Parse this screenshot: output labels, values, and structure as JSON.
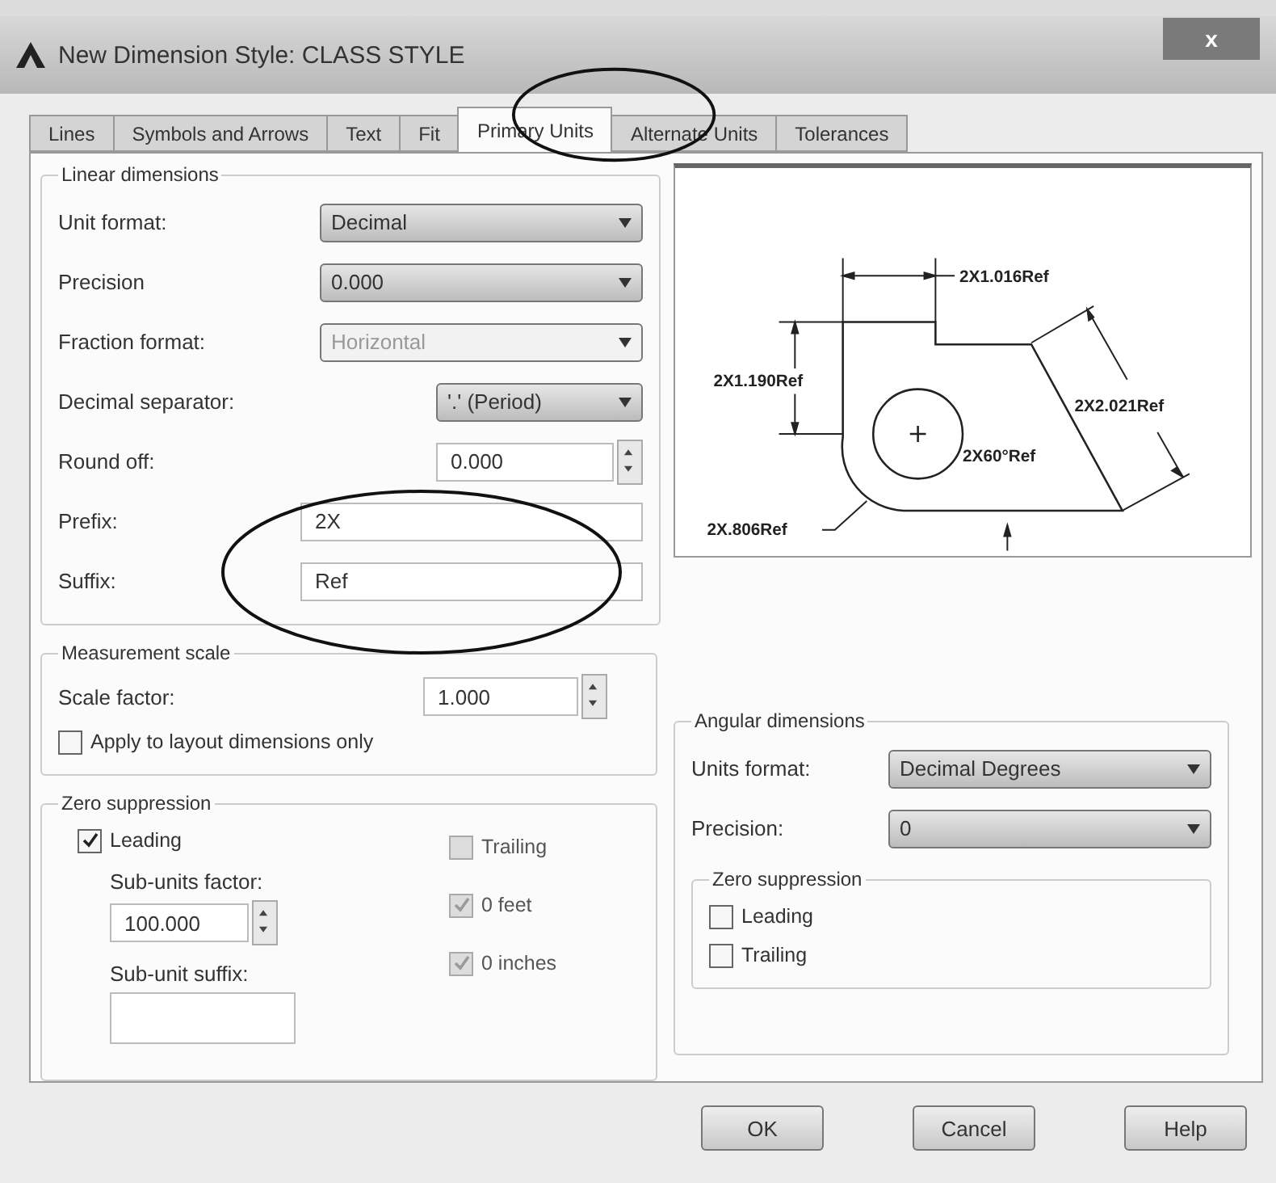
{
  "window": {
    "title": "New Dimension Style: CLASS STYLE",
    "close": "x"
  },
  "tabs": [
    {
      "label": "Lines",
      "selected": false
    },
    {
      "label": "Symbols and Arrows",
      "selected": false
    },
    {
      "label": "Text",
      "selected": false
    },
    {
      "label": "Fit",
      "selected": false
    },
    {
      "label": "Primary Units",
      "selected": true
    },
    {
      "label": "Alternate Units",
      "selected": false
    },
    {
      "label": "Tolerances",
      "selected": false
    }
  ],
  "linear": {
    "title": "Linear dimensions",
    "fields": [
      {
        "kind": "dropdown",
        "label": "Unit format:",
        "value": "Decimal"
      },
      {
        "kind": "dropdown",
        "label": "Precision",
        "value": "0.000"
      },
      {
        "kind": "dropdown",
        "label": "Fraction format:",
        "value": "Horizontal",
        "disabled": true
      },
      {
        "kind": "narrow_dropdown",
        "label": "Decimal separator:",
        "value": "'.' (Period)"
      },
      {
        "kind": "spinner",
        "label": "Round off:",
        "value": "0.000"
      },
      {
        "kind": "text",
        "label": "Prefix:",
        "value": "2X"
      },
      {
        "kind": "text",
        "label": "Suffix:",
        "value": "Ref"
      }
    ]
  },
  "measurement_scale": {
    "title": "Measurement scale",
    "scale_label": "Scale factor:",
    "scale_value": "1.000",
    "apply": {
      "label": "Apply to layout dimensions only",
      "checked": false
    }
  },
  "zero_suppression": {
    "title": "Zero suppression",
    "leading": {
      "label": "Leading",
      "checked": true,
      "disabled": false
    },
    "sub_units_factor_label": "Sub-units factor:",
    "sub_units_factor": "100.000",
    "sub_unit_suffix_label": "Sub-unit suffix:",
    "options": [
      {
        "label": "Trailing",
        "checked": false,
        "disabled": true
      },
      {
        "label": "0 feet",
        "checked": true,
        "disabled": true
      },
      {
        "label": "0 inches",
        "checked": true,
        "disabled": true
      }
    ]
  },
  "preview": {
    "labels": [
      "2X1.016Ref",
      "2X1.190Ref",
      "2X2.021Ref",
      "2X60°Ref",
      "2X.806Ref"
    ]
  },
  "angular": {
    "title": "Angular dimensions",
    "fields": [
      {
        "label": "Units format:",
        "value": "Decimal Degrees"
      },
      {
        "label": "Precision:",
        "value": "0"
      }
    ],
    "zero_suppression": {
      "title": "Zero suppression",
      "options": [
        {
          "label": "Leading",
          "checked": false
        },
        {
          "label": "Trailing",
          "checked": false
        }
      ]
    }
  },
  "buttons": [
    "OK",
    "Cancel",
    "Help"
  ]
}
